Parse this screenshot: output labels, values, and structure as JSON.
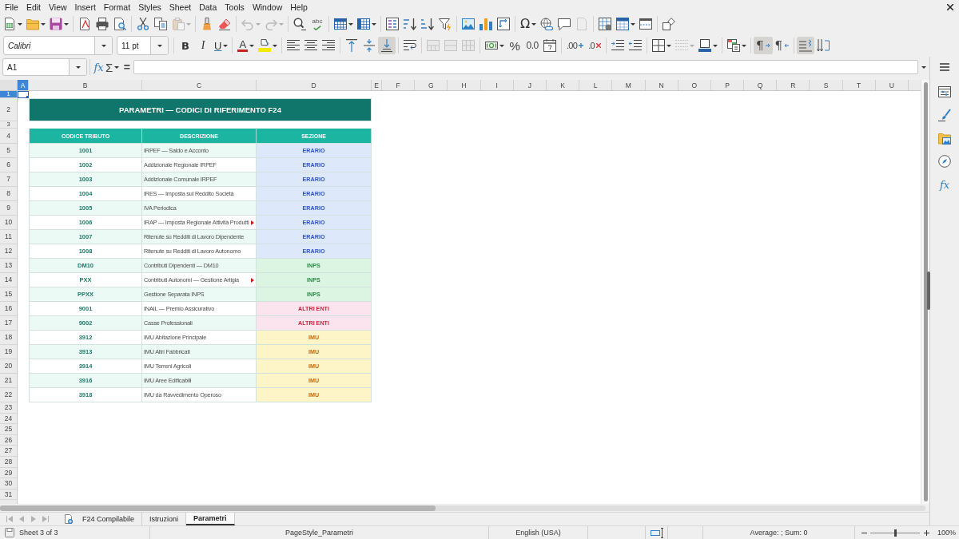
{
  "menu": [
    "File",
    "Edit",
    "View",
    "Insert",
    "Format",
    "Styles",
    "Sheet",
    "Data",
    "Tools",
    "Window",
    "Help"
  ],
  "standard_toolbar": {
    "buttons": [
      {
        "disabled": false
      },
      {
        "disabled": false
      },
      {
        "disabled": false
      },
      {
        "disabled": false
      },
      {
        "disabled": false
      },
      {
        "disabled": false
      },
      {
        "disabled": false
      },
      {
        "disabled": false
      },
      {
        "disabled": true
      },
      {
        "disabled": false
      },
      {
        "disabled": false
      },
      {
        "disabled": true
      },
      {
        "disabled": true
      },
      {
        "disabled": false
      },
      {
        "disabled": false,
        "glyph": "abc"
      },
      {
        "disabled": false
      },
      {
        "disabled": false
      },
      {
        "disabled": false
      },
      {
        "disabled": false
      },
      {
        "disabled": false
      },
      {
        "disabled": false
      },
      {
        "disabled": false
      },
      {
        "disabled": false
      },
      {
        "disabled": false
      },
      {
        "disabled": false,
        "glyph": "Ω"
      },
      {
        "disabled": false
      },
      {
        "disabled": false
      },
      {
        "disabled": true
      },
      {
        "disabled": false
      },
      {
        "disabled": false
      },
      {
        "disabled": false
      },
      {
        "disabled": false
      }
    ]
  },
  "formatting_toolbar": {
    "font_name": "Calibri",
    "font_size": "11 pt",
    "buttons": [
      {
        "on": false,
        "disabled": false,
        "glyph": "B"
      },
      {
        "on": false,
        "disabled": false,
        "glyph": "I"
      },
      {
        "on": false,
        "disabled": false,
        "glyph": "U"
      },
      {
        "on": false,
        "disabled": false,
        "glyph": "A"
      },
      {
        "on": false,
        "disabled": false
      },
      {
        "on": false,
        "disabled": false
      },
      {
        "on": false,
        "disabled": false
      },
      {
        "on": false,
        "disabled": false
      },
      {
        "on": false,
        "disabled": false
      },
      {
        "on": false,
        "disabled": false
      },
      {
        "on": true,
        "disabled": false
      },
      {
        "on": false,
        "disabled": false
      },
      {
        "on": false,
        "disabled": true
      },
      {
        "on": false,
        "disabled": true
      },
      {
        "on": false,
        "disabled": true
      },
      {
        "on": false,
        "disabled": false
      },
      {
        "on": false,
        "disabled": false,
        "glyph": "%"
      },
      {
        "on": false,
        "disabled": false,
        "glyph": "0.0"
      },
      {
        "on": false,
        "disabled": false
      },
      {
        "on": false,
        "disabled": false,
        "glyph": ".00"
      },
      {
        "on": false,
        "disabled": false,
        "glyph": ".0"
      },
      {
        "on": false,
        "disabled": false
      },
      {
        "on": false,
        "disabled": false
      },
      {
        "on": false,
        "disabled": false
      },
      {
        "on": false,
        "disabled": true
      },
      {
        "on": false,
        "disabled": false
      },
      {
        "on": false,
        "disabled": false
      },
      {
        "on": true,
        "disabled": false,
        "glyph": "¶"
      },
      {
        "on": false,
        "disabled": false,
        "glyph": "¶"
      },
      {
        "on": true,
        "disabled": false
      },
      {
        "on": false,
        "disabled": false
      }
    ]
  },
  "formula_bar": {
    "cell_reference": "A1",
    "buttons": [
      {
        "glyph": "fx"
      },
      {
        "glyph": "Σ"
      },
      {
        "glyph": "="
      }
    ]
  },
  "sidebar": {
    "functions_glyph": "fx"
  },
  "sheet": {
    "columns": [
      {
        "label": "A",
        "selected": true
      },
      {
        "label": "B",
        "selected": false
      },
      {
        "label": "C",
        "selected": false
      },
      {
        "label": "D",
        "selected": false
      },
      {
        "label": "E",
        "selected": false
      },
      {
        "label": "F",
        "selected": false
      },
      {
        "label": "G",
        "selected": false
      },
      {
        "label": "H",
        "selected": false
      },
      {
        "label": "I",
        "selected": false
      },
      {
        "label": "J",
        "selected": false
      },
      {
        "label": "K",
        "selected": false
      },
      {
        "label": "L",
        "selected": false
      },
      {
        "label": "M",
        "selected": false
      },
      {
        "label": "N",
        "selected": false
      },
      {
        "label": "O",
        "selected": false
      },
      {
        "label": "P",
        "selected": false
      },
      {
        "label": "Q",
        "selected": false
      },
      {
        "label": "R",
        "selected": false
      },
      {
        "label": "S",
        "selected": false
      },
      {
        "label": "T",
        "selected": false
      },
      {
        "label": "U",
        "selected": false
      }
    ],
    "rows": [
      {
        "label": "1",
        "selected": true
      },
      {
        "label": "2",
        "selected": false
      },
      {
        "label": "3",
        "selected": false
      },
      {
        "label": "4",
        "selected": false
      },
      {
        "label": "5",
        "selected": false
      },
      {
        "label": "6",
        "selected": false
      },
      {
        "label": "7",
        "selected": false
      },
      {
        "label": "8",
        "selected": false
      },
      {
        "label": "9",
        "selected": false
      },
      {
        "label": "10",
        "selected": false
      },
      {
        "label": "11",
        "selected": false
      },
      {
        "label": "12",
        "selected": false
      },
      {
        "label": "13",
        "selected": false
      },
      {
        "label": "14",
        "selected": false
      },
      {
        "label": "15",
        "selected": false
      },
      {
        "label": "16",
        "selected": false
      },
      {
        "label": "17",
        "selected": false
      },
      {
        "label": "18",
        "selected": false
      },
      {
        "label": "19",
        "selected": false
      },
      {
        "label": "20",
        "selected": false
      },
      {
        "label": "21",
        "selected": false
      },
      {
        "label": "22",
        "selected": false
      },
      {
        "label": "23",
        "selected": false
      },
      {
        "label": "24",
        "selected": false
      },
      {
        "label": "25",
        "selected": false
      },
      {
        "label": "26",
        "selected": false
      },
      {
        "label": "27",
        "selected": false
      },
      {
        "label": "28",
        "selected": false
      },
      {
        "label": "29",
        "selected": false
      },
      {
        "label": "30",
        "selected": false
      },
      {
        "label": "31",
        "selected": false
      }
    ],
    "title": "PARAMETRI — CODICI DI RIFERIMENTO F24",
    "headers": [
      "CODICE TRIBUTO",
      "DESCRIZIONE",
      "SEZIONE"
    ],
    "records": [
      {
        "code": "1001",
        "description": "IRPEF — Saldo e Acconto",
        "section": "ERARIO",
        "kind": "erario",
        "overflow": false
      },
      {
        "code": "1002",
        "description": "Addizionale Regionale IRPEF",
        "section": "ERARIO",
        "kind": "erario",
        "overflow": false
      },
      {
        "code": "1003",
        "description": "Addizionale Comunale IRPEF",
        "section": "ERARIO",
        "kind": "erario",
        "overflow": false
      },
      {
        "code": "1004",
        "description": "IRES — Imposta sul Reddito Società",
        "section": "ERARIO",
        "kind": "erario",
        "overflow": false
      },
      {
        "code": "1005",
        "description": "IVA Periodica",
        "section": "ERARIO",
        "kind": "erario",
        "overflow": false
      },
      {
        "code": "1006",
        "description": "IRAP — Imposta Regionale Attività Produtti",
        "section": "ERARIO",
        "kind": "erario",
        "overflow": true
      },
      {
        "code": "1007",
        "description": "Ritenute su Redditi di Lavoro Dipendente",
        "section": "ERARIO",
        "kind": "erario",
        "overflow": false
      },
      {
        "code": "1008",
        "description": "Ritenute su Redditi di Lavoro Autonomo",
        "section": "ERARIO",
        "kind": "erario",
        "overflow": false
      },
      {
        "code": "DM10",
        "description": "Contributi Dipendenti — DM10",
        "section": "INPS",
        "kind": "inps",
        "overflow": false
      },
      {
        "code": "PXX",
        "description": "Contributi Autonomi — Gestione Artigia",
        "section": "INPS",
        "kind": "inps",
        "overflow": true
      },
      {
        "code": "PPXX",
        "description": "Gestione Separata INPS",
        "section": "INPS",
        "kind": "inps",
        "overflow": false
      },
      {
        "code": "9001",
        "description": "INAIL — Premio Assicurativo",
        "section": "ALTRI ENTI",
        "kind": "altri_enti",
        "overflow": false
      },
      {
        "code": "9002",
        "description": "Casse Professionali",
        "section": "ALTRI ENTI",
        "kind": "altri_enti",
        "overflow": false
      },
      {
        "code": "3912",
        "description": "IMU Abitazione Principale",
        "section": "IMU",
        "kind": "imu",
        "overflow": false
      },
      {
        "code": "3913",
        "description": "IMU Altri Fabbricati",
        "section": "IMU",
        "kind": "imu",
        "overflow": false
      },
      {
        "code": "3914",
        "description": "IMU Terreni Agricoli",
        "section": "IMU",
        "kind": "imu",
        "overflow": false
      },
      {
        "code": "3916",
        "description": "IMU Aree Edificabili",
        "section": "IMU",
        "kind": "imu",
        "overflow": false
      },
      {
        "code": "3918",
        "description": "IMU da Ravvedimento Operoso",
        "section": "IMU",
        "kind": "imu",
        "overflow": false
      }
    ]
  },
  "sheet_navigation": [
    {
      "disabled": true
    },
    {
      "disabled": true
    },
    {
      "disabled": true
    },
    {
      "disabled": true
    }
  ],
  "sheet_tabs": [
    {
      "label": "F24 Compilabile",
      "selected": false
    },
    {
      "label": "Istruzioni",
      "selected": false
    },
    {
      "label": "Parametri",
      "selected": true
    }
  ],
  "status_bar": {
    "sheet": "Sheet 3 of 3",
    "page_style": "PageStyle_Parametri",
    "language": "English (USA)",
    "summary": "Average: ; Sum: 0",
    "zoom_slider": {
      "level": 0.5
    },
    "zoom": "100%"
  }
}
